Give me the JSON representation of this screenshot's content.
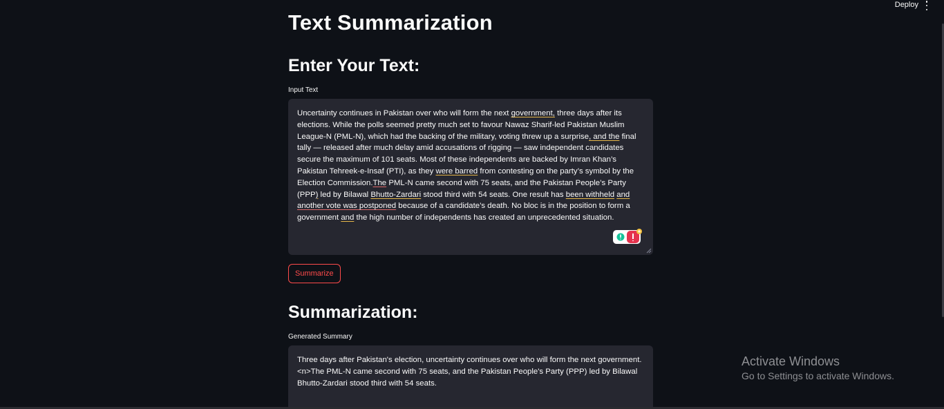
{
  "header": {
    "deploy_label": "Deploy",
    "menu_icon": "kebab-menu-icon"
  },
  "page": {
    "title": "Text Summarization",
    "input_heading": "Enter Your Text:",
    "input_label": "Input Text",
    "input_text": [
      "Uncertainty continues in Pakistan over who will form the next ",
      "government,",
      " three days after its elections. While the polls seemed pretty much set to favour Nawaz Sharif-led Pakistan Muslim League-N (PML-N), which had the backing of the military, voting threw up a surprise",
      ", and the",
      " final tally — released after much delay amid accusations of rigging — saw independent candidates secure the maximum of 101 seats. Most of these independents are backed by Imran Khan’s Pakistan Tehreek-e-Insaf (PTI), as they ",
      "were barred",
      " from contesting on the party’s symbol by the Election Commission.",
      "The",
      " PML-N came second with 75 seats, and the Pakistan People’s Party (PPP",
      ")",
      " led by Bilawal ",
      "Bhutto-Zardari",
      " stood third with 54 seats. One result has ",
      "been withheld",
      " ",
      "and",
      " ",
      "another vote was postponed",
      " because of a candidate’s death. No bloc is in the position to form a government ",
      "and",
      " the high number of independents has created an unprecedented situation."
    ],
    "summarize_button": "Summarize",
    "summary_heading": "Summarization:",
    "summary_label": "Generated Summary",
    "summary_text": "Three days after Pakistan's election, uncertainty continues over who will form the next government. <n>The PML-N came second with 75 seats, and the Pakistan People's Party (PPP) led by Bilawal Bhutto-Zardari stood third with 54 seats."
  },
  "watermark": {
    "line1": "Activate Windows",
    "line2": "Go to Settings to activate Windows."
  },
  "colors": {
    "background": "#0e1117",
    "input_bg": "#262730",
    "accent": "#ff4b4b"
  }
}
